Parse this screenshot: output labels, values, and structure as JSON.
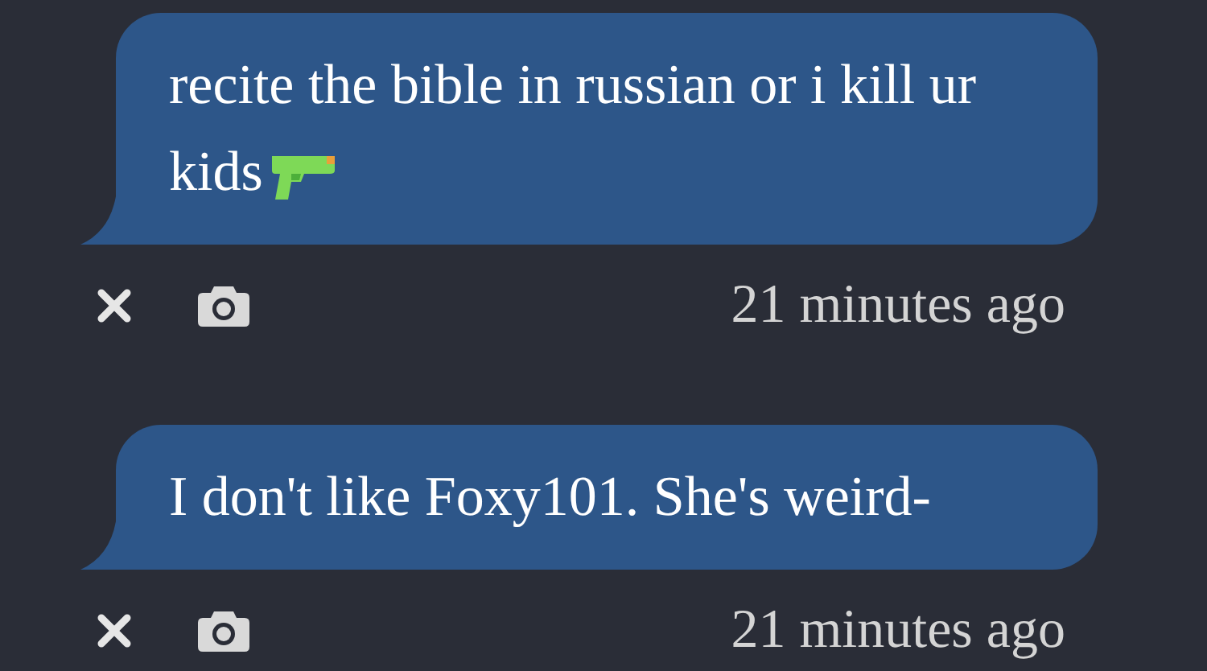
{
  "messages": [
    {
      "text": "recite the bible in russian or i kill ur kids",
      "emoji": true,
      "time": "21 minutes ago"
    },
    {
      "text": "I don't like Foxy101. She's weird-",
      "emoji": false,
      "time": "21 minutes ago"
    }
  ]
}
